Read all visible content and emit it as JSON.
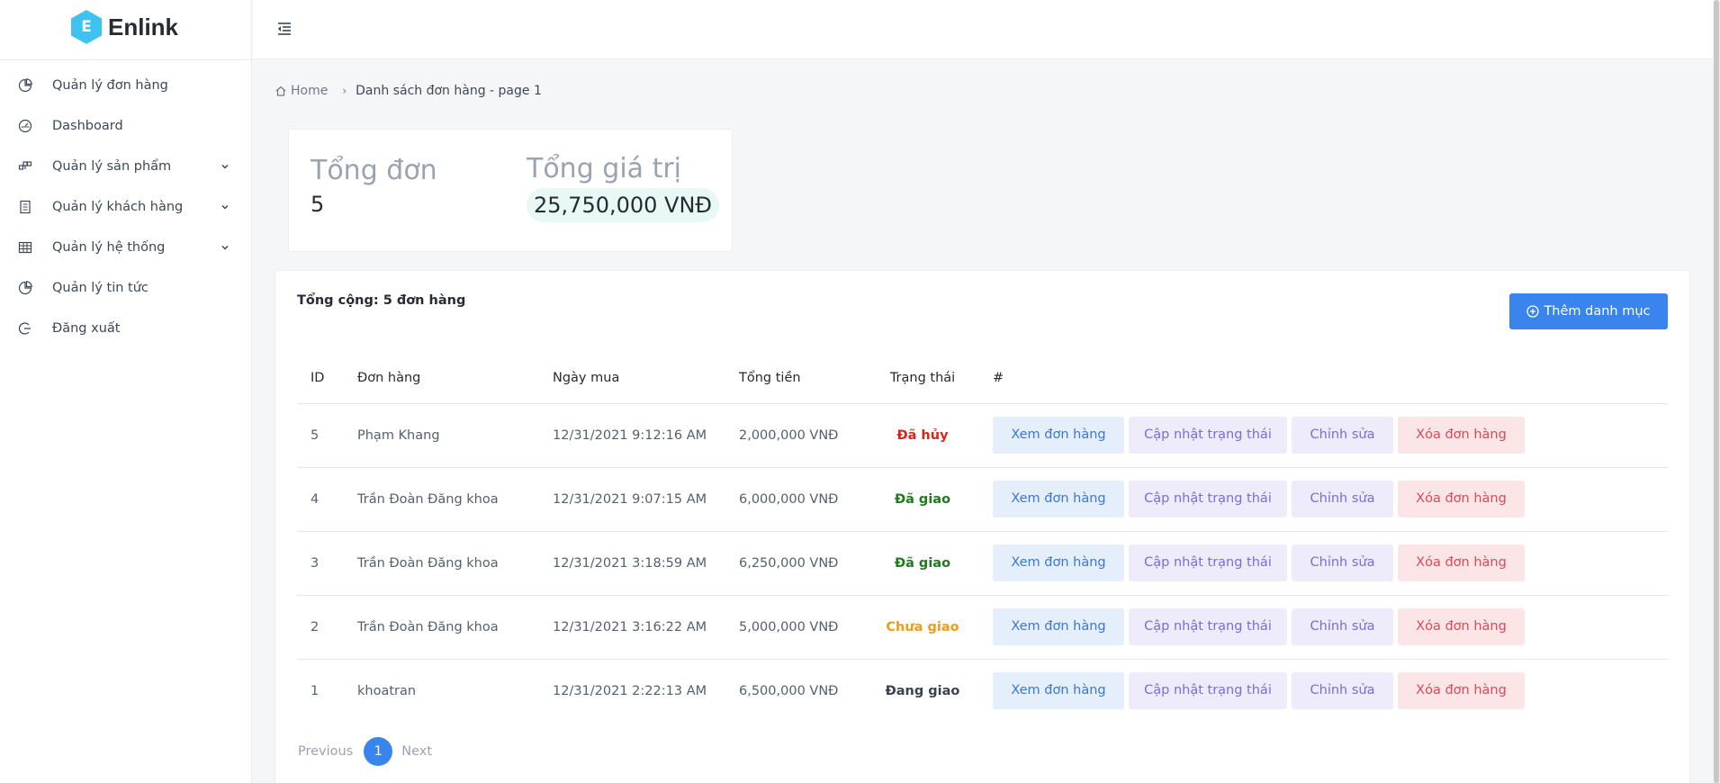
{
  "brand": {
    "logo_letter": "E",
    "name": "Enlink"
  },
  "sidebar": {
    "items": [
      {
        "label": "Quản lý đơn hàng",
        "icon": "pie-chart-icon",
        "expandable": false
      },
      {
        "label": "Dashboard",
        "icon": "dashboard-icon",
        "expandable": false
      },
      {
        "label": "Quản lý sản phẩm",
        "icon": "build-icon",
        "expandable": true
      },
      {
        "label": "Quản lý khách hàng",
        "icon": "book-icon",
        "expandable": true
      },
      {
        "label": "Quản lý hệ thống",
        "icon": "table-icon",
        "expandable": true
      },
      {
        "label": "Quản lý tin tức",
        "icon": "pie-chart-icon",
        "expandable": false
      },
      {
        "label": "Đăng xuất",
        "icon": "logout-icon",
        "expandable": false
      }
    ]
  },
  "breadcrumb": {
    "home": "Home",
    "current": "Danh sách đơn hàng - page 1"
  },
  "summary": {
    "orders_title": "Tổng đơn",
    "orders_value": "5",
    "value_title": "Tổng giá trị",
    "value_amount": "25,750,000 VNĐ"
  },
  "card": {
    "total_label": "Tổng cộng: 5 đơn hàng",
    "add_button": "Thêm danh mục"
  },
  "table": {
    "headers": {
      "id": "ID",
      "order": "Đơn hàng",
      "date": "Ngày mua",
      "total": "Tổng tiền",
      "status": "Trạng thái",
      "actions": "#"
    },
    "action_labels": {
      "view": "Xem đơn hàng",
      "update": "Cập nhật trạng thái",
      "edit": "Chỉnh sửa",
      "delete": "Xóa đơn hàng"
    },
    "rows": [
      {
        "id": "5",
        "name": "Phạm Khang",
        "date": "12/31/2021 9:12:16 AM",
        "total": "2,000,000 VNĐ",
        "status": "Đã hủy",
        "status_color": "#d9251e"
      },
      {
        "id": "4",
        "name": "Trần Đoàn Đăng khoa",
        "date": "12/31/2021 9:07:15 AM",
        "total": "6,000,000 VNĐ",
        "status": "Đã giao",
        "status_color": "#1f7a1f"
      },
      {
        "id": "3",
        "name": "Trần Đoàn Đăng khoa",
        "date": "12/31/2021 3:18:59 AM",
        "total": "6,250,000 VNĐ",
        "status": "Đã giao",
        "status_color": "#1f7a1f"
      },
      {
        "id": "2",
        "name": "Trần Đoàn Đăng khoa",
        "date": "12/31/2021 3:16:22 AM",
        "total": "5,000,000 VNĐ",
        "status": "Chưa giao",
        "status_color": "#f29b18"
      },
      {
        "id": "1",
        "name": "khoatran",
        "date": "12/31/2021 2:22:13 AM",
        "total": "6,500,000 VNĐ",
        "status": "Đang giao",
        "status_color": "#3c4350"
      }
    ]
  },
  "pagination": {
    "previous": "Previous",
    "current": "1",
    "next": "Next"
  },
  "colors": {
    "primary": "#3a84ee",
    "logo": "#3ec2f2"
  }
}
